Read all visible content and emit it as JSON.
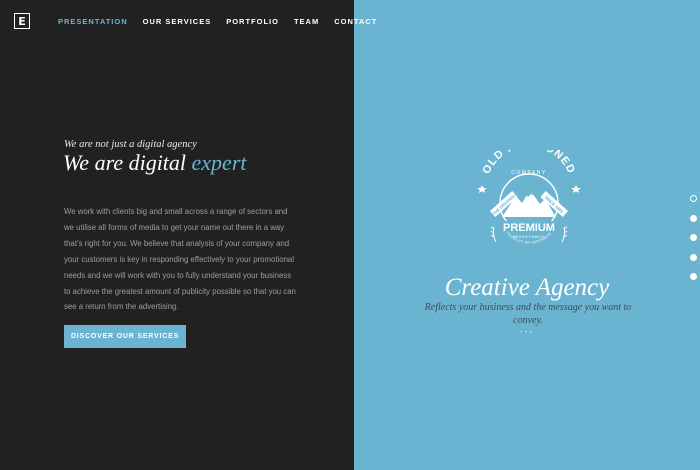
{
  "brand": {
    "logo_letter": "E"
  },
  "nav": {
    "items": [
      {
        "label": "PRESENTATION",
        "active": true
      },
      {
        "label": "OUR SERVICES",
        "active": false
      },
      {
        "label": "PORTFOLIO",
        "active": false
      },
      {
        "label": "TEAM",
        "active": false
      },
      {
        "label": "CONTACT",
        "active": false
      }
    ]
  },
  "hero": {
    "tagline": "We are not just a digital agency",
    "headline_main": "We are digital ",
    "headline_accent": "expert",
    "body": "We work with clients big and small across a range of sectors and we utilise all forms of media to get your name out there in a way that’s right for you. We believe that analysis of your company and your customers is key in responding effectively to your promotional needs and we will work with you to fully understand your business to achieve the greatest amount of publicity possible so that you can see a return from the advertising.",
    "cta_label": "DISCOVER OUR SERVICES"
  },
  "badge": {
    "title": "OLD FASHIONED",
    "company": "COMPANY",
    "ribbon_left": "THE ORIGINAL",
    "ribbon_right": "SINCE 1983",
    "premium": "PREMIUM",
    "subline": "BEACH FAMILY",
    "footer": "PRODUCT OF HAPPINESS"
  },
  "feature": {
    "title": "Creative Agency",
    "description": "Reflects your business and the message you want to convey.",
    "divider": "---"
  },
  "pagination": {
    "count": 5,
    "active_index": 0
  },
  "colors": {
    "accent": "#6ab4d1",
    "dark_bg": "#212122",
    "light_text": "#ffffff"
  }
}
